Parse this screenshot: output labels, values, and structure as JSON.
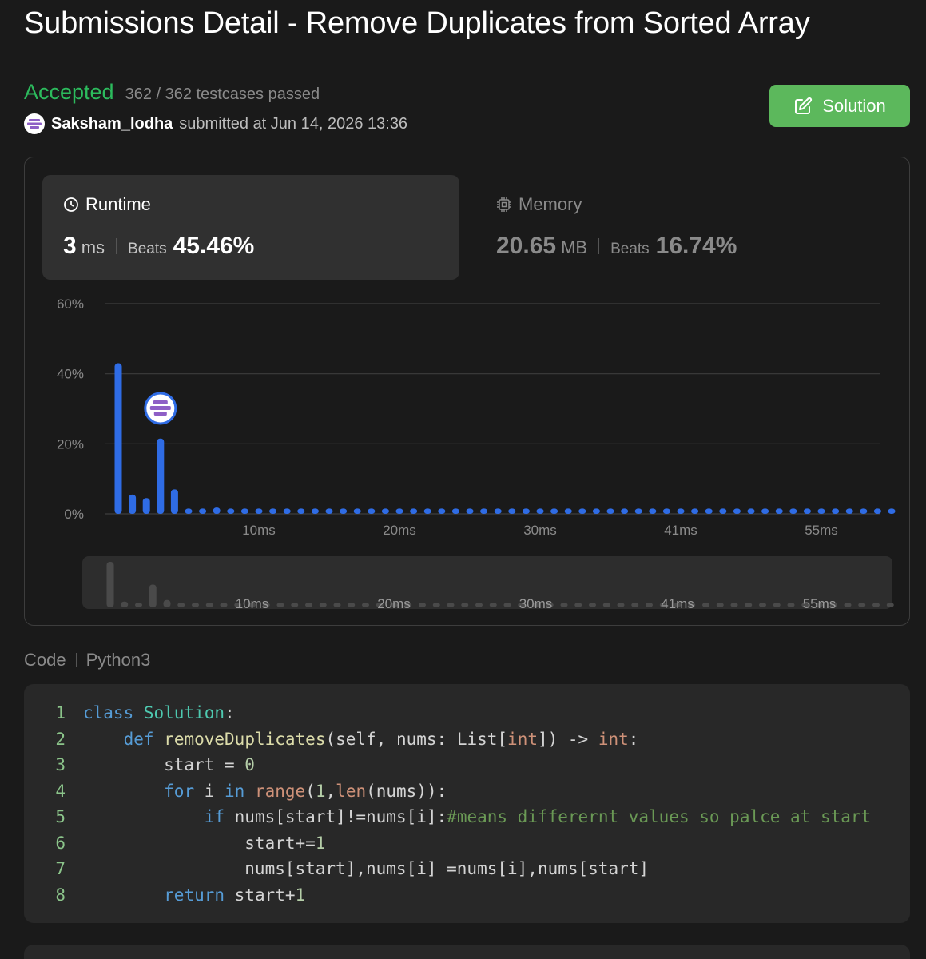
{
  "page": {
    "title": "Submissions Detail - Remove Duplicates from Sorted Array"
  },
  "status": {
    "label": "Accepted",
    "testcases": "362 / 362 testcases passed"
  },
  "submitter": {
    "username": "Saksham_lodha",
    "submitted_at": "submitted at Jun 14, 2026 13:36"
  },
  "actions": {
    "solution_label": "Solution"
  },
  "runtime": {
    "title": "Runtime",
    "value": "3",
    "unit": "ms",
    "beats_label": "Beats",
    "beats_value": "45.46%"
  },
  "memory": {
    "title": "Memory",
    "value": "20.65",
    "unit": "MB",
    "beats_label": "Beats",
    "beats_value": "16.74%"
  },
  "colors": {
    "accepted": "#2cbb5d",
    "bar": "#2f6ce5",
    "solution_button": "#5cb85c",
    "background": "#1a1a1a"
  },
  "icons": {
    "solution": "edit-icon",
    "runtime": "clock-icon",
    "memory": "chip-icon"
  },
  "chart_data": {
    "type": "bar",
    "title": "",
    "xlabel": "",
    "ylabel": "",
    "ylim": [
      0,
      60
    ],
    "y_ticks": [
      "60%",
      "40%",
      "20%",
      "0%"
    ],
    "x_tick_labels": [
      "10ms",
      "20ms",
      "30ms",
      "41ms",
      "55ms"
    ],
    "x_tick_bar_index": [
      10,
      20,
      30,
      40,
      50
    ],
    "values": [
      43,
      5.5,
      4.5,
      21.5,
      7,
      1.5,
      1.5,
      1.8,
      1.5,
      1.5,
      1.5,
      1.5,
      1.5,
      1.5,
      1.5,
      1.5,
      1.5,
      1.5,
      1.5,
      1.5,
      1.5,
      1.5,
      1.5,
      1.5,
      1.5,
      1.5,
      1.5,
      1.5,
      1.5,
      1.5,
      1.5,
      1.5,
      1.5,
      1.5,
      1.5,
      1.5,
      1.5,
      1.5,
      1.5,
      1.5,
      1.5,
      1.5,
      1.5,
      1.5,
      1.5,
      1.5,
      1.5,
      1.5,
      1.5,
      1.5,
      1.5,
      1.5,
      1.5,
      1.5,
      1.5,
      1.5
    ],
    "user_bar_index": 3,
    "grid": true
  },
  "code": {
    "label": "Code",
    "language": "Python3",
    "lines": [
      {
        "num": "1"
      },
      {
        "num": "2"
      },
      {
        "num": "3"
      },
      {
        "num": "4"
      },
      {
        "num": "5"
      },
      {
        "num": "6"
      },
      {
        "num": "7"
      },
      {
        "num": "8"
      }
    ],
    "tokens": {
      "l1": [
        "class",
        " ",
        "Solution",
        ":"
      ],
      "l2": [
        "    ",
        "def",
        " ",
        "removeDuplicates",
        "(self, nums: List[",
        "int",
        "]) -> ",
        "int",
        ":"
      ],
      "l3": [
        "        start = ",
        "0"
      ],
      "l4": [
        "        ",
        "for",
        " i ",
        "in",
        " ",
        "range",
        "(",
        "1",
        ",",
        "len",
        "(nums)):"
      ],
      "l5": [
        "            ",
        "if",
        " nums[start]!=nums[i]:",
        "#means differernt values so palce at start"
      ],
      "l6": [
        "                start+=",
        "1"
      ],
      "l7": [
        "                nums[start],nums[i] =nums[i],nums[start]"
      ],
      "l8": [
        "        ",
        "return",
        " start+",
        "1"
      ]
    }
  }
}
